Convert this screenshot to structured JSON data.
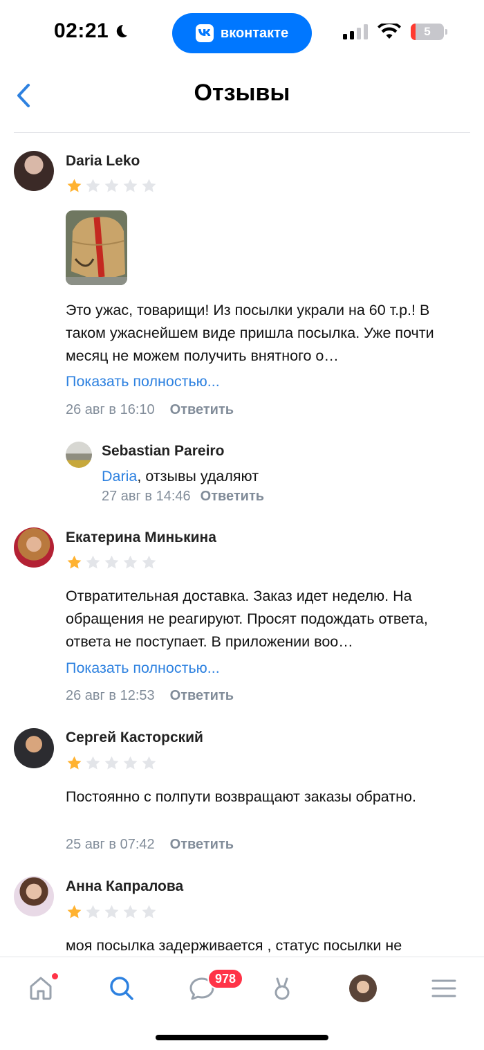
{
  "status_bar": {
    "time": "02:21",
    "app_pill": "вконтакте",
    "battery": "5"
  },
  "header": {
    "title": "Отзывы"
  },
  "reviews": [
    {
      "author": "Daria Leko",
      "rating": 1,
      "text": "Это ужас, товарищи! Из посылки украли на 60 т.р.! В таком ужаснейшем виде пришла посылка. Уже почти месяц не можем получить внятного о…",
      "show_more": "Показать полностью...",
      "date": "26 авг в 16:10",
      "reply": "Ответить",
      "replies": [
        {
          "author": "Sebastian Pareiro",
          "mention": "Daria",
          "text": ", отзывы удаляют",
          "date": "27 авг в 14:46",
          "reply": "Ответить"
        }
      ]
    },
    {
      "author": "Екатерина Минькина",
      "rating": 1,
      "text": "Отвратительная доставка. Заказ идет неделю. На обращения не реагируют. Просят подождать ответа, ответа не поступает. В приложении воо…",
      "show_more": "Показать полностью...",
      "date": "26 авг в 12:53",
      "reply": "Ответить"
    },
    {
      "author": "Сергей Касторский",
      "rating": 1,
      "text": "Постоянно с полпути возвращают заказы обратно.",
      "date": "25 авг в 07:42",
      "reply": "Ответить"
    },
    {
      "author": "Анна Капралова",
      "rating": 1,
      "text": "моя посылка задерживается , статус посылки не"
    }
  ],
  "tab_bar": {
    "tabs": [
      "home-icon",
      "search-icon",
      "messages-icon",
      "clips-icon",
      "profile-avatar",
      "menu-icon"
    ],
    "messages_badge": "978"
  },
  "colors": {
    "accent": "#0077ff",
    "link": "#2d81e0",
    "star": "#ffb230",
    "badge": "#ff3347"
  }
}
